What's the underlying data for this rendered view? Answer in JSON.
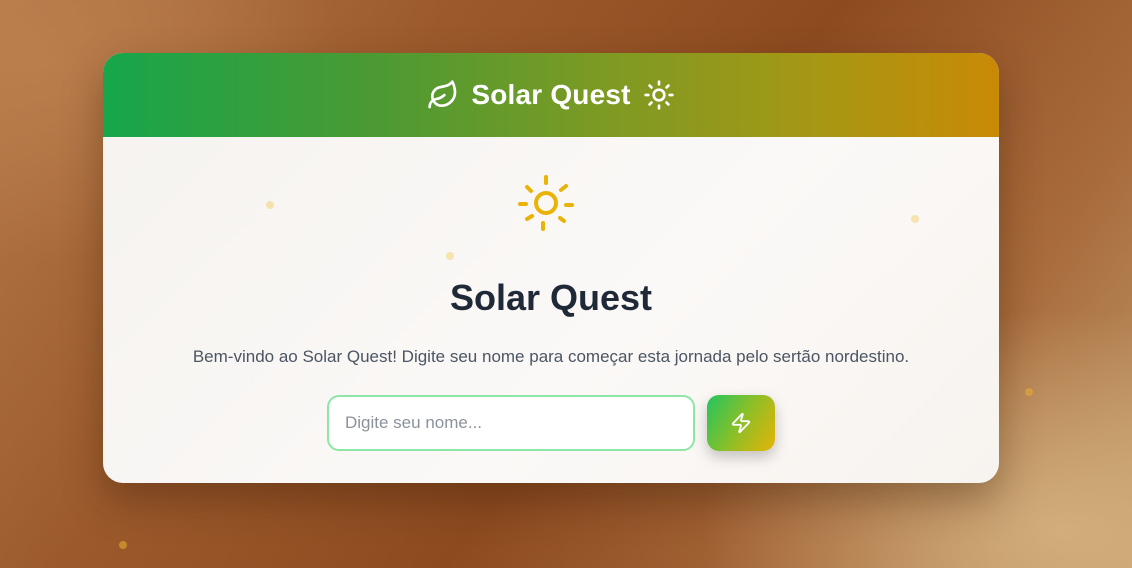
{
  "header": {
    "title": "Solar Quest",
    "left_icon": "leaf-icon",
    "right_icon": "sun-icon"
  },
  "hero": {
    "icon": "sun-icon",
    "title": "Solar Quest",
    "description": "Bem-vindo ao Solar Quest! Digite seu nome para começar esta jornada pelo sertão nordestino."
  },
  "form": {
    "name_placeholder": "Digite seu nome...",
    "name_value": "",
    "submit_icon": "lightning-icon"
  },
  "colors": {
    "brand_green": "#16a64b",
    "brand_gold": "#c98a06",
    "sun_yellow": "#eab308",
    "input_border": "#8ee6a6",
    "title_text": "#1f2937"
  }
}
